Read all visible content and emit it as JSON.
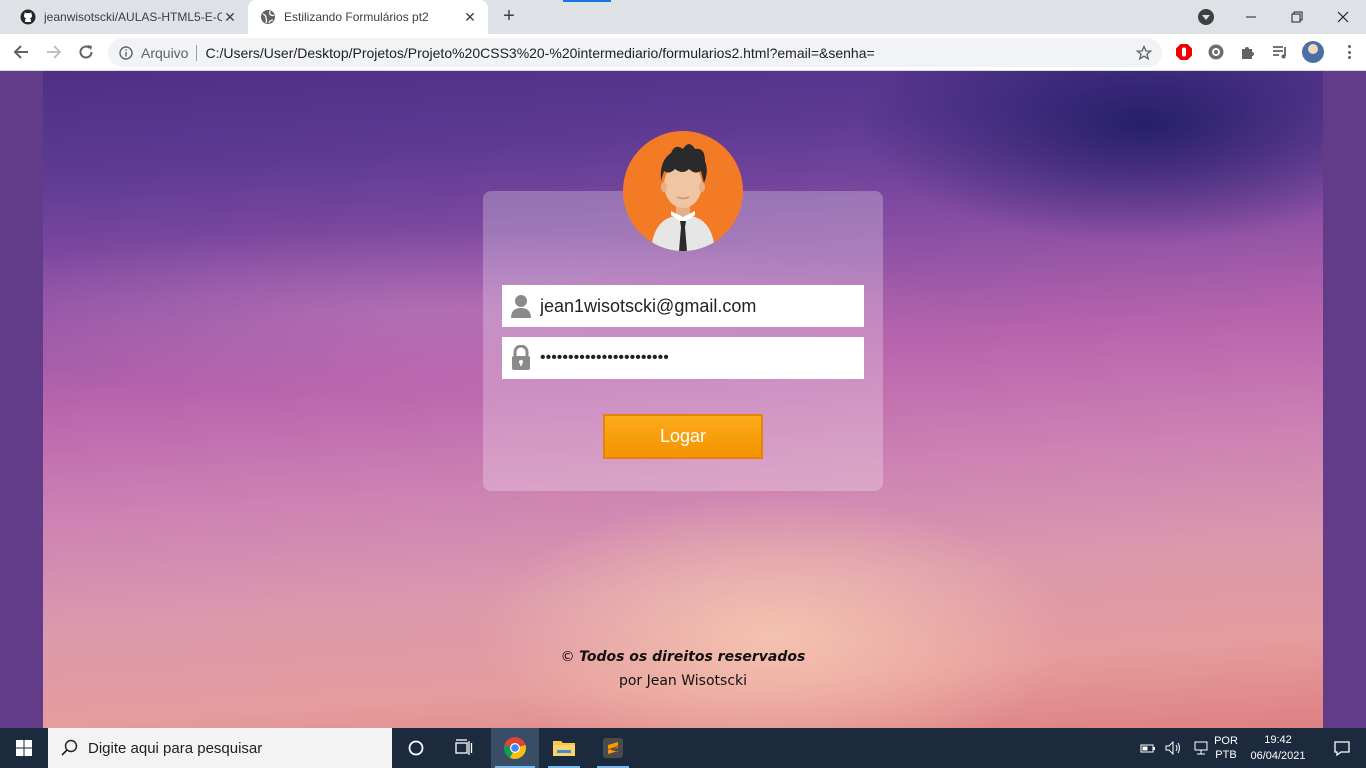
{
  "browser": {
    "tabs": [
      {
        "title": "jeanwisotscki/AULAS-HTML5-E-C",
        "favicon": "github-icon",
        "active": false
      },
      {
        "title": "Estilizando Formulários pt2",
        "favicon": "globe-icon",
        "active": true
      }
    ],
    "omnibox": {
      "scheme_label": "Arquivo",
      "url": "C:/Users/User/Desktop/Projetos/Projeto%20CSS3%20-%20intermediario/formularios2.html?email=&senha="
    }
  },
  "page": {
    "form": {
      "email_value": "jean1wisotscki@gmail.com",
      "password_value": "•••••••••••••••••••••••",
      "login_label": "Logar"
    },
    "footer": {
      "copyright_symbol": "©",
      "rights": "Todos os direitos reservados",
      "author": "por Jean Wisotscki"
    },
    "colors": {
      "button": "#f59300",
      "avatar_bg": "#f47b26",
      "page_side": "#623c88"
    }
  },
  "taskbar": {
    "search_placeholder": "Digite aqui para pesquisar",
    "lang_line1": "POR",
    "lang_line2": "PTB",
    "time": "19:42",
    "date": "06/04/2021"
  }
}
